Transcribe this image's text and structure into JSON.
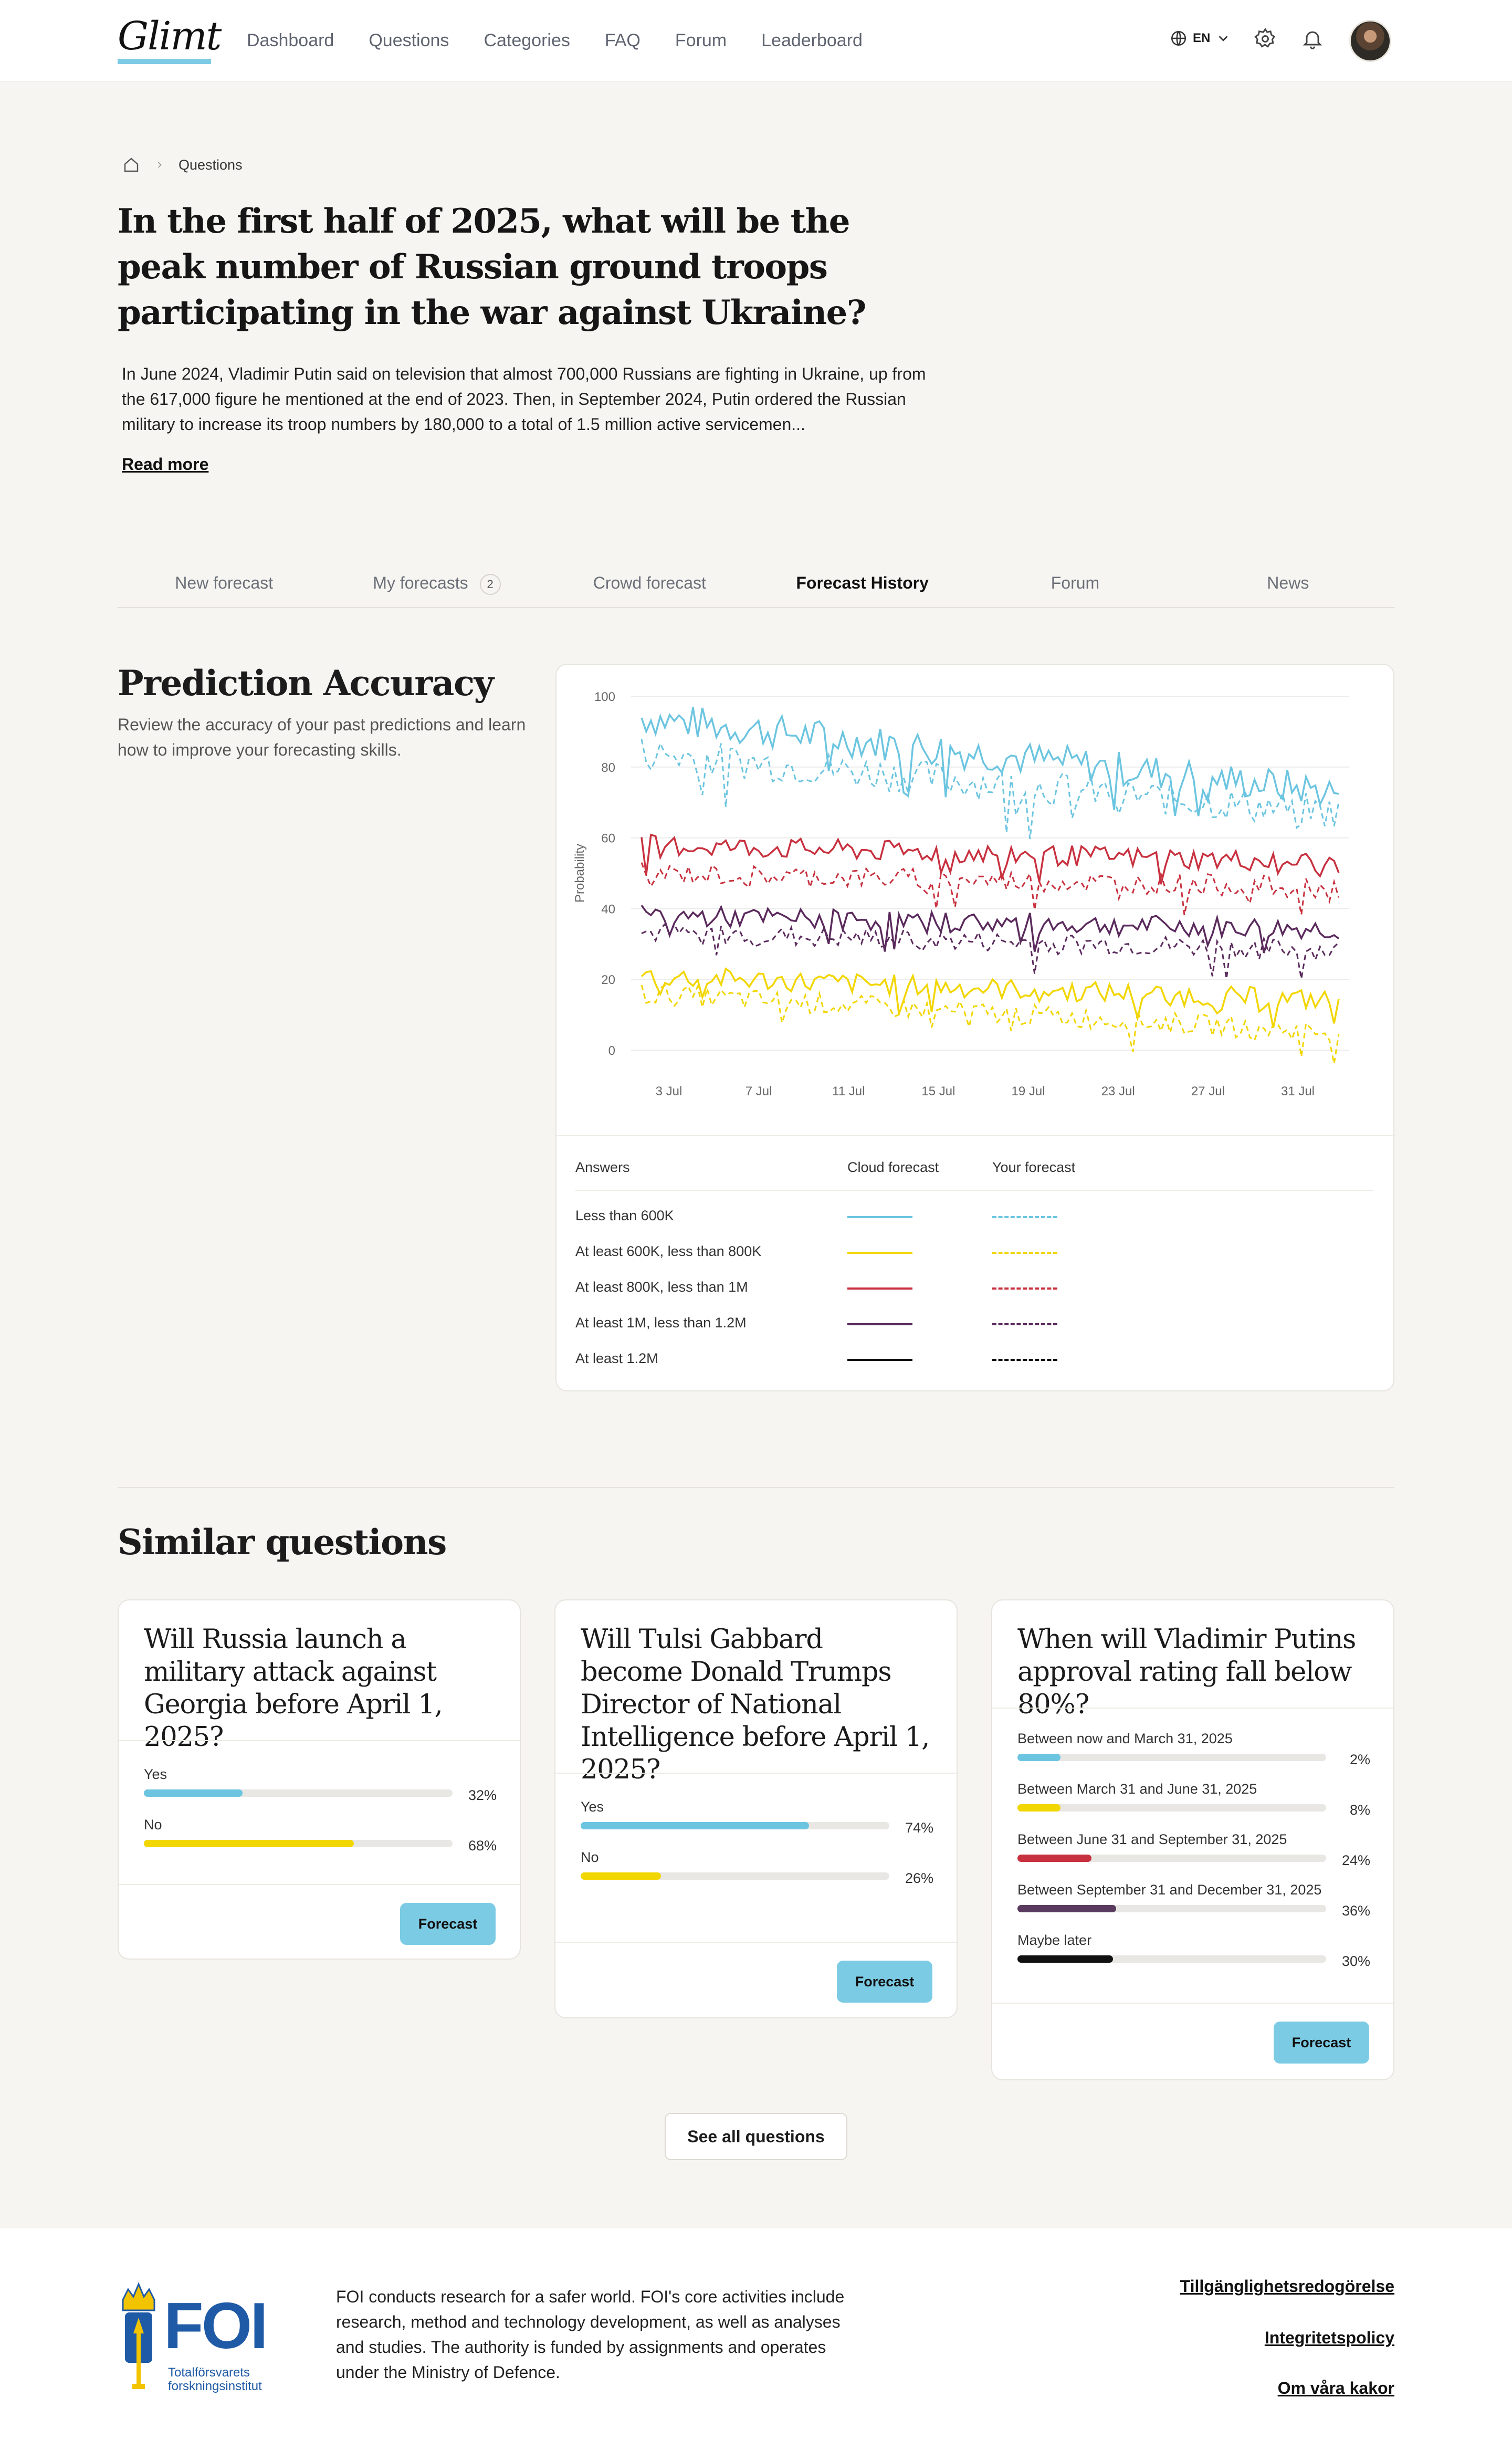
{
  "header": {
    "logo": "Glimt",
    "nav": [
      "Dashboard",
      "Questions",
      "Categories",
      "FAQ",
      "Forum",
      "Leaderboard"
    ],
    "lang": "EN",
    "icons": [
      "globe-icon",
      "chevron-down-icon",
      "gear-icon",
      "bell-icon",
      "avatar"
    ]
  },
  "breadcrumb": {
    "current": "Questions"
  },
  "question": {
    "title": "In the first half of 2025, what will be the peak number of Russian ground troops participating in the war against Ukraine?",
    "intro": "In June 2024, Vladimir Putin said on television that almost 700,000 Russians are fighting in Ukraine, up from the 617,000 figure he mentioned at the end of 2023. Then, in September 2024, Putin ordered the Russian military to increase its troop numbers by 180,000 to a total of 1.5 million active servicemen...",
    "read_more": "Read more"
  },
  "tabs": [
    {
      "label": "New forecast"
    },
    {
      "label": "My forecasts",
      "badge": "2"
    },
    {
      "label": "Crowd forecast"
    },
    {
      "label": "Forecast History",
      "active": true
    },
    {
      "label": "Forum"
    },
    {
      "label": "News"
    }
  ],
  "accuracy": {
    "title": "Prediction Accuracy",
    "description": "Review the accuracy of your past predictions and learn how to improve your forecasting skills."
  },
  "chart_data": {
    "type": "line",
    "ylabel": "Probability",
    "ylim": [
      0,
      100
    ],
    "yticks": [
      0,
      20,
      40,
      60,
      80,
      100
    ],
    "xticks": [
      "3 Jul",
      "7 Jul",
      "11 Jul",
      "15 Jul",
      "19 Jul",
      "23 Jul",
      "27 Jul",
      "31 Jul"
    ],
    "x_range": [
      "1 Jul",
      "1 Aug"
    ],
    "grid": true,
    "legend_headers": {
      "answers": "Answers",
      "cloud": "Cloud forecast",
      "yours": "Your forecast"
    },
    "series": [
      {
        "name": "Less than 600K",
        "color": "#6cc5e0",
        "cloud_start": 94,
        "cloud_end": 73,
        "yours_start": 84,
        "yours_end": 67
      },
      {
        "name": "At least 600K, less than 800K",
        "color": "#f2d600",
        "cloud_start": 21,
        "cloud_end": 14,
        "yours_start": 16,
        "yours_end": 5
      },
      {
        "name": "At least 800K, less than 1M",
        "color": "#c8313f",
        "cloud_start": 58,
        "cloud_end": 53,
        "yours_start": 50,
        "yours_end": 46
      },
      {
        "name": "At least 1M, less than 1.2M",
        "color": "#5a2a5c",
        "cloud_start": 38,
        "cloud_end": 34,
        "yours_start": 33,
        "yours_end": 28
      },
      {
        "name": "At least 1.2M",
        "color": "#111111",
        "legend_only": true
      }
    ]
  },
  "similar": {
    "title": "Similar questions",
    "forecast_label": "Forecast",
    "see_all": "See all questions",
    "questions": [
      {
        "title": "Will Russia launch a military attack against Georgia before April 1, 2025?",
        "options": [
          {
            "label": "Yes",
            "pct": "32%",
            "value": 32,
            "color": "#6cc5e0"
          },
          {
            "label": "No",
            "pct": "68%",
            "value": 68,
            "color": "#f2d600"
          }
        ]
      },
      {
        "title": "Will Tulsi Gabbard become Donald Trumps Director of National Intelligence before April 1, 2025?",
        "options": [
          {
            "label": "Yes",
            "pct": "74%",
            "value": 74,
            "color": "#6cc5e0"
          },
          {
            "label": "No",
            "pct": "26%",
            "value": 26,
            "color": "#f2d600"
          }
        ]
      },
      {
        "title": "When will Vladimir Putins approval rating fall below 80%?",
        "options": [
          {
            "label": "Between now and March 31, 2025",
            "pct": "2%",
            "value": 14,
            "color": "#6cc5e0"
          },
          {
            "label": "Between March 31 and June 31, 2025",
            "pct": "8%",
            "value": 14,
            "color": "#f2d600"
          },
          {
            "label": "Between June 31 and September 31, 2025",
            "pct": "24%",
            "value": 24,
            "color": "#c8313f"
          },
          {
            "label": "Between September 31 and December 31, 2025",
            "pct": "36%",
            "value": 32,
            "color": "#5a3a5e"
          },
          {
            "label": "Maybe later",
            "pct": "30%",
            "value": 31,
            "color": "#111111"
          }
        ]
      }
    ]
  },
  "footer": {
    "logo_text": "FOI",
    "logo_sub": "Totalförsvarets forskningsinstitut",
    "about": "FOI conducts research for a safer world. FOI's core activities include research, method and technology development, as well as analyses and studies. The authority is funded by assignments and operates under the Ministry of Defence.",
    "links": [
      "Tillgänglighetsredogörelse",
      "Integritetspolicy",
      "Om våra kakor"
    ]
  }
}
